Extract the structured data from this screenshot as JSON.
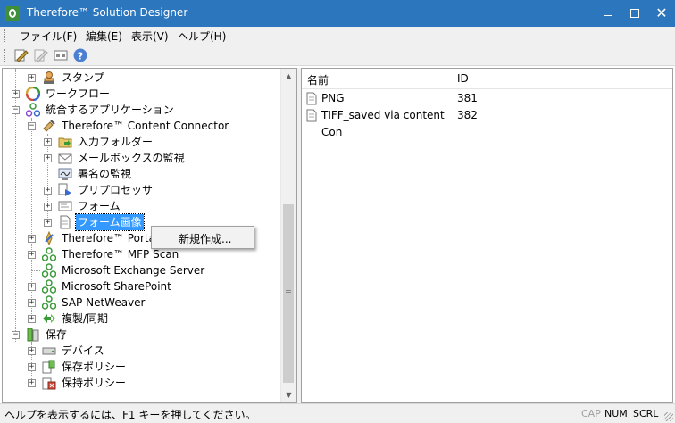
{
  "window": {
    "title": "Therefore™ Solution Designer"
  },
  "menu": {
    "items": [
      "ファイル(F)",
      "編集(E)",
      "表示(V)",
      "ヘルプ(H)"
    ]
  },
  "tree": {
    "nodes": [
      {
        "label": "スタンプ",
        "icon": "stamp-icon"
      },
      {
        "label": "ワークフロー",
        "icon": "workflow-icon"
      },
      {
        "label": "統合するアプリケーション",
        "icon": "integration-icon"
      },
      {
        "label": "Therefore™ Content Connector",
        "icon": "connector-icon"
      },
      {
        "label": "入力フォルダー",
        "icon": "input-folder-icon"
      },
      {
        "label": "メールボックスの監視",
        "icon": "mailbox-icon"
      },
      {
        "label": "署名の監視",
        "icon": "signature-monitor-icon"
      },
      {
        "label": "プリプロセッサ",
        "icon": "preprocessor-icon"
      },
      {
        "label": "フォーム",
        "icon": "form-icon"
      },
      {
        "label": "フォーム画像",
        "icon": "form-image-icon"
      },
      {
        "label": "Therefore™ Portal",
        "icon": "portal-icon"
      },
      {
        "label": "Therefore™ MFP Scan",
        "icon": "mfp-scan-icon"
      },
      {
        "label": "Microsoft Exchange Server",
        "icon": "exchange-icon"
      },
      {
        "label": "Microsoft SharePoint",
        "icon": "sharepoint-icon"
      },
      {
        "label": "SAP NetWeaver",
        "icon": "sap-icon"
      },
      {
        "label": "複製/同期",
        "icon": "sync-icon"
      },
      {
        "label": "保存",
        "icon": "storage-icon"
      },
      {
        "label": "デバイス",
        "icon": "device-icon"
      },
      {
        "label": "保存ポリシー",
        "icon": "storage-policy-icon"
      },
      {
        "label": "保持ポリシー",
        "icon": "retention-policy-icon"
      }
    ]
  },
  "list": {
    "columns": [
      "名前",
      "ID"
    ],
    "rows": [
      {
        "name": "PNG",
        "id": "381"
      },
      {
        "name": "TIFF_saved via content Con",
        "id": "382"
      }
    ]
  },
  "context_menu": {
    "items": [
      "新規作成..."
    ]
  },
  "status": {
    "text": "ヘルプを表示するには、F1 キーを押してください。",
    "indicators": [
      "CAP",
      "NUM",
      "SCRL"
    ]
  },
  "colors": {
    "titlebar": "#2c76be",
    "selection": "#3399ff"
  }
}
